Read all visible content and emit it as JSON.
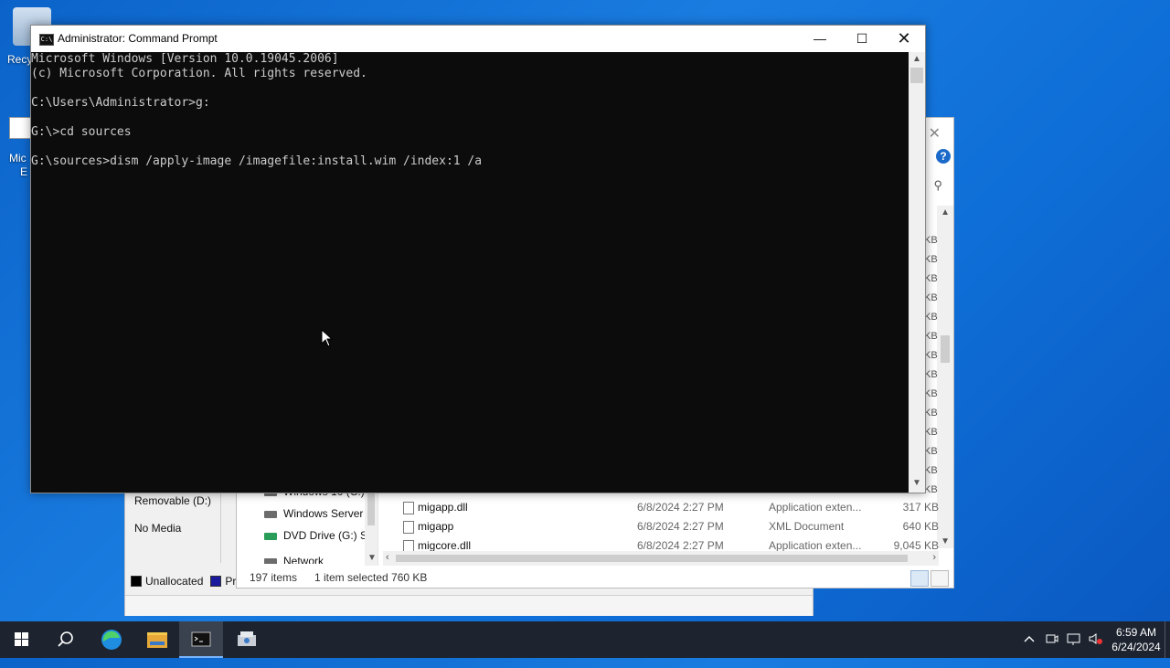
{
  "desktop": {
    "recycle_label": "Recy",
    "edge_label_1": "Mic",
    "edge_label_2": "E"
  },
  "disk_mgmt": {
    "removable": "Removable (D:)",
    "no_media": "No Media",
    "legend": [
      {
        "label": "Unallocated",
        "color": "#000000"
      },
      {
        "label": "Pri",
        "color": "#1a1a9c"
      }
    ]
  },
  "explorer": {
    "close_glyph": "✕",
    "help_glyph": "?",
    "kb_labels": [
      "KB",
      "KB",
      "KB",
      "KB",
      "KB",
      "KB",
      "KB",
      "KB",
      "KB",
      "KB",
      "KB",
      "KB",
      "KB",
      "KB"
    ],
    "nav_items": [
      {
        "label": "Windows 10 (C:)",
        "icon": "drive-icon"
      },
      {
        "label": "Windows Server",
        "icon": "drive-icon"
      },
      {
        "label": "DVD Drive (G:) S:",
        "icon": "dvd-icon"
      },
      {
        "label": "Network",
        "icon": "network-icon"
      }
    ],
    "files": [
      {
        "name": "migapp.dll",
        "date": "6/8/2024 2:27 PM",
        "type": "Application exten...",
        "size": "317 KB"
      },
      {
        "name": "migapp",
        "date": "6/8/2024 2:27 PM",
        "type": "XML Document",
        "size": "640 KB"
      },
      {
        "name": "migcore.dll",
        "date": "6/8/2024 2:27 PM",
        "type": "Application exten...",
        "size": "9,045 KB"
      }
    ],
    "status_items": "197 items",
    "status_selected": "1 item selected  760 KB"
  },
  "cmd": {
    "title": "Administrator: Command Prompt",
    "icon_text": "C:\\",
    "minimize_glyph": "—",
    "maximize_glyph": "☐",
    "close_glyph": "✕",
    "output": "Microsoft Windows [Version 10.0.19045.2006]\n(c) Microsoft Corporation. All rights reserved.\n\nC:\\Users\\Administrator>g:\n\nG:\\>cd sources\n\nG:\\sources>dism /apply-image /imagefile:install.wim /index:1 /a"
  },
  "taskbar": {
    "apps": [
      "start-icon",
      "search-icon",
      "edge-icon",
      "file-explorer-icon",
      "command-prompt-icon",
      "setup-icon"
    ],
    "time": "6:59 AM",
    "date": "6/24/2024"
  }
}
